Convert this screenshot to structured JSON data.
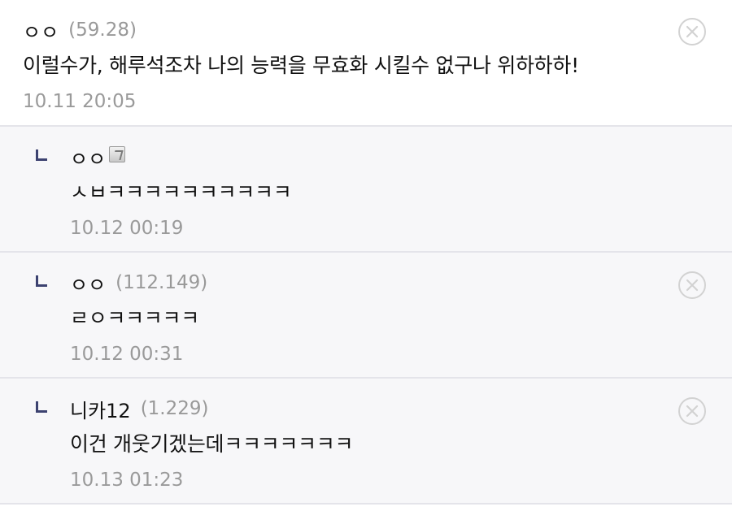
{
  "comments": [
    {
      "nickname": "ㅇㅇ",
      "ip": "(59.28)",
      "text": "이럴수가, 해루석조차 나의 능력을 무효화 시킬수 없구나 위하하하!",
      "date": "10.11 20:05",
      "icons": [
        "delete-icon"
      ]
    }
  ],
  "replies": [
    {
      "nickname": "ㅇㅇ",
      "ip": "",
      "text": "ㅅㅂㅋㅋㅋㅋㅋㅋㅋㅋㅋㅋ",
      "date": "10.12 00:19",
      "icons": [
        "reply-arrow-icon",
        "fixed-member-icon"
      ]
    },
    {
      "nickname": "ㅇㅇ",
      "ip": "(112.149)",
      "text": "ㄹㅇㅋㅋㅋㅋㅋ",
      "date": "10.12 00:31",
      "icons": [
        "reply-arrow-icon",
        "delete-icon"
      ]
    },
    {
      "nickname": "니카12",
      "ip": "(1.229)",
      "text": "이건 개웃기겠는데ㅋㅋㅋㅋㅋㅋㅋ",
      "date": "10.13 01:23",
      "icons": [
        "reply-arrow-icon",
        "delete-icon"
      ]
    }
  ],
  "colors": {
    "background": "#ffffff",
    "reply_background": "#f7f7f9",
    "divider": "#e4e4ea",
    "muted_text": "#999999",
    "reply_arrow": "#3c4270",
    "delete_icon": "#d2d2d2"
  }
}
